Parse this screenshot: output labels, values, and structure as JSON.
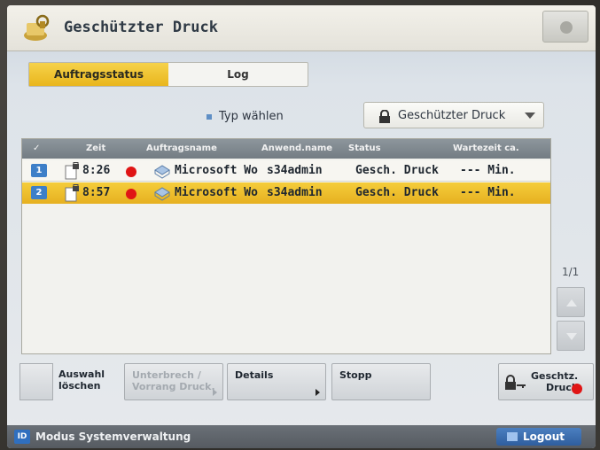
{
  "header": {
    "title": "Geschützter Druck",
    "app_icon": "secure-print-icon"
  },
  "tabs": [
    {
      "label": "Auftragsstatus",
      "active": true
    },
    {
      "label": "Log",
      "active": false
    }
  ],
  "type_filter": {
    "label": "Typ wählen",
    "selected": "Geschützter Druck"
  },
  "table": {
    "columns": [
      "Zeit",
      "Auftragsname",
      "Anwend.name",
      "Status",
      "Wartezeit ca."
    ],
    "rows": [
      {
        "index": "1",
        "time": "8:26",
        "job_name": "Microsoft Wo",
        "user": "s34admin",
        "status": "Gesch. Druck",
        "wait": "--- Min.",
        "selected": false
      },
      {
        "index": "2",
        "time": "8:57",
        "job_name": "Microsoft Wo",
        "user": "s34admin",
        "status": "Gesch. Druck",
        "wait": "--- Min.",
        "selected": true
      }
    ]
  },
  "pager": "1/1",
  "buttons": {
    "clear_selection": "Auswahl\nlöschen",
    "interrupt": "Unterbrech /\nVorrang Druck.",
    "details": "Details",
    "stop": "Stopp",
    "secure_print": "Geschtz.\nDruck"
  },
  "statusbar": {
    "id_badge": "ID",
    "mode": "Modus Systemverwaltung",
    "logout": "Logout"
  },
  "colors": {
    "accent_yellow": "#F1C232",
    "red_marker": "#E01515",
    "badge_blue": "#3D7FC8"
  }
}
